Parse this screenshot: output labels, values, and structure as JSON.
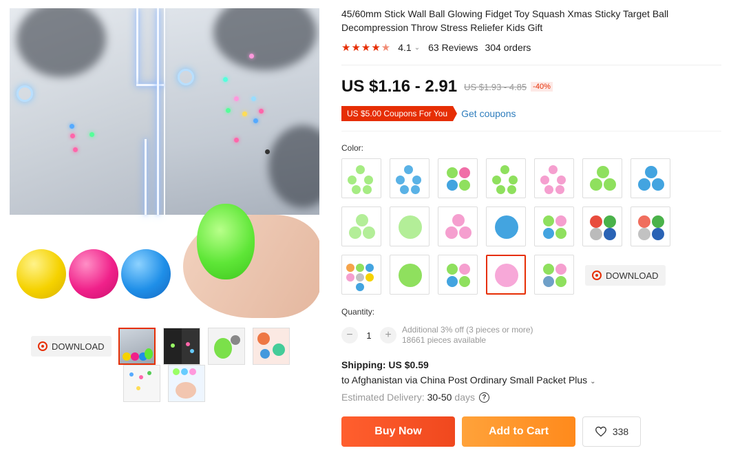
{
  "product": {
    "title": "45/60mm Stick Wall Ball Glowing Fidget Toy Squash Xmas Sticky Target Ball Decompression Throw Stress Reliefer Kids Gift",
    "rating": "4.1",
    "rating_stars": 4.1,
    "reviews": "63 Reviews",
    "orders": "304 orders",
    "price": "US $1.16 - 2.91",
    "original_price": "US $1.93 - 4.85",
    "discount": "-40%",
    "coupon": "US $5.00 Coupons For You",
    "get_coupons": "Get coupons"
  },
  "gallery": {
    "download_label": "DOWNLOAD",
    "thumbnails": [
      "thumb-1",
      "thumb-2",
      "thumb-3",
      "thumb-4",
      "thumb-5",
      "thumb-6"
    ],
    "active_thumbnail": 0
  },
  "options": {
    "color_label": "Color:",
    "selected_index": 16,
    "download_label": "DOWNLOAD"
  },
  "quantity": {
    "label": "Quantity:",
    "minus": "−",
    "plus": "+",
    "value": "1",
    "discount_info": "Additional 3% off (3 pieces or more)",
    "available": "18661 pieces available"
  },
  "shipping": {
    "label": "Shipping: US $0.59",
    "destination": "to Afghanistan via China Post Ordinary Small Packet Plus",
    "delivery_label": "Estimated Delivery:",
    "delivery_value": "30-50",
    "delivery_unit": "days",
    "help": "?"
  },
  "actions": {
    "buy_now": "Buy Now",
    "add_to_cart": "Add to Cart",
    "wishlist_count": "338"
  },
  "colors": {
    "accent": "#e62e04",
    "buy_now": "#f55a2c",
    "add_to_cart": "#ff9a2e",
    "link": "#2e7dbd"
  }
}
